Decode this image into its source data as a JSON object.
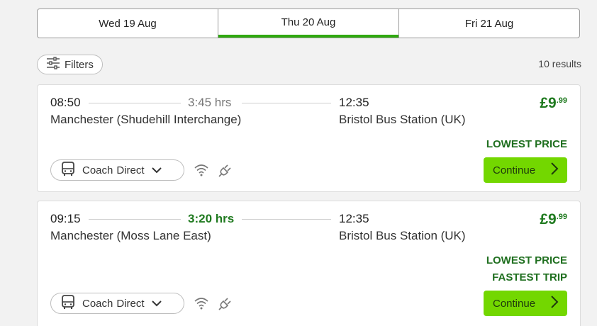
{
  "date_tabs": [
    {
      "label": "Wed 19 Aug",
      "active": false
    },
    {
      "label": "Thu 20 Aug",
      "active": true
    },
    {
      "label": "Fri 21 Aug",
      "active": false
    }
  ],
  "filters": {
    "label": "Filters"
  },
  "results": {
    "count_label": "10 results"
  },
  "trips": [
    {
      "departure_time": "08:50",
      "duration": "3:45 hrs",
      "arrival_time": "12:35",
      "departure_station": "Manchester (Shudehill Interchange)",
      "arrival_station": "Bristol Bus Station (UK)",
      "price_main": "£9",
      "price_decimal": ".99",
      "badges": [
        "LOWEST PRICE"
      ],
      "mode_word1": "Coach",
      "mode_word2": "Direct",
      "continue_label": "Continue"
    },
    {
      "departure_time": "09:15",
      "duration": "3:20 hrs",
      "arrival_time": "12:35",
      "departure_station": "Manchester (Moss Lane East)",
      "arrival_station": "Bristol Bus Station (UK)",
      "price_main": "£9",
      "price_decimal": ".99",
      "badges": [
        "LOWEST PRICE",
        "FASTEST TRIP"
      ],
      "mode_word1": "Coach",
      "mode_word2": "Direct",
      "continue_label": "Continue"
    }
  ],
  "colors": {
    "accent_green": "#73d700",
    "active_tab_underline": "#2fa90f",
    "price_green": "#1f7a1f"
  },
  "icons": [
    "filter-sliders-icon",
    "bus-icon",
    "chevron-down-icon",
    "wifi-icon",
    "power-plug-icon",
    "chevron-right-icon"
  ]
}
